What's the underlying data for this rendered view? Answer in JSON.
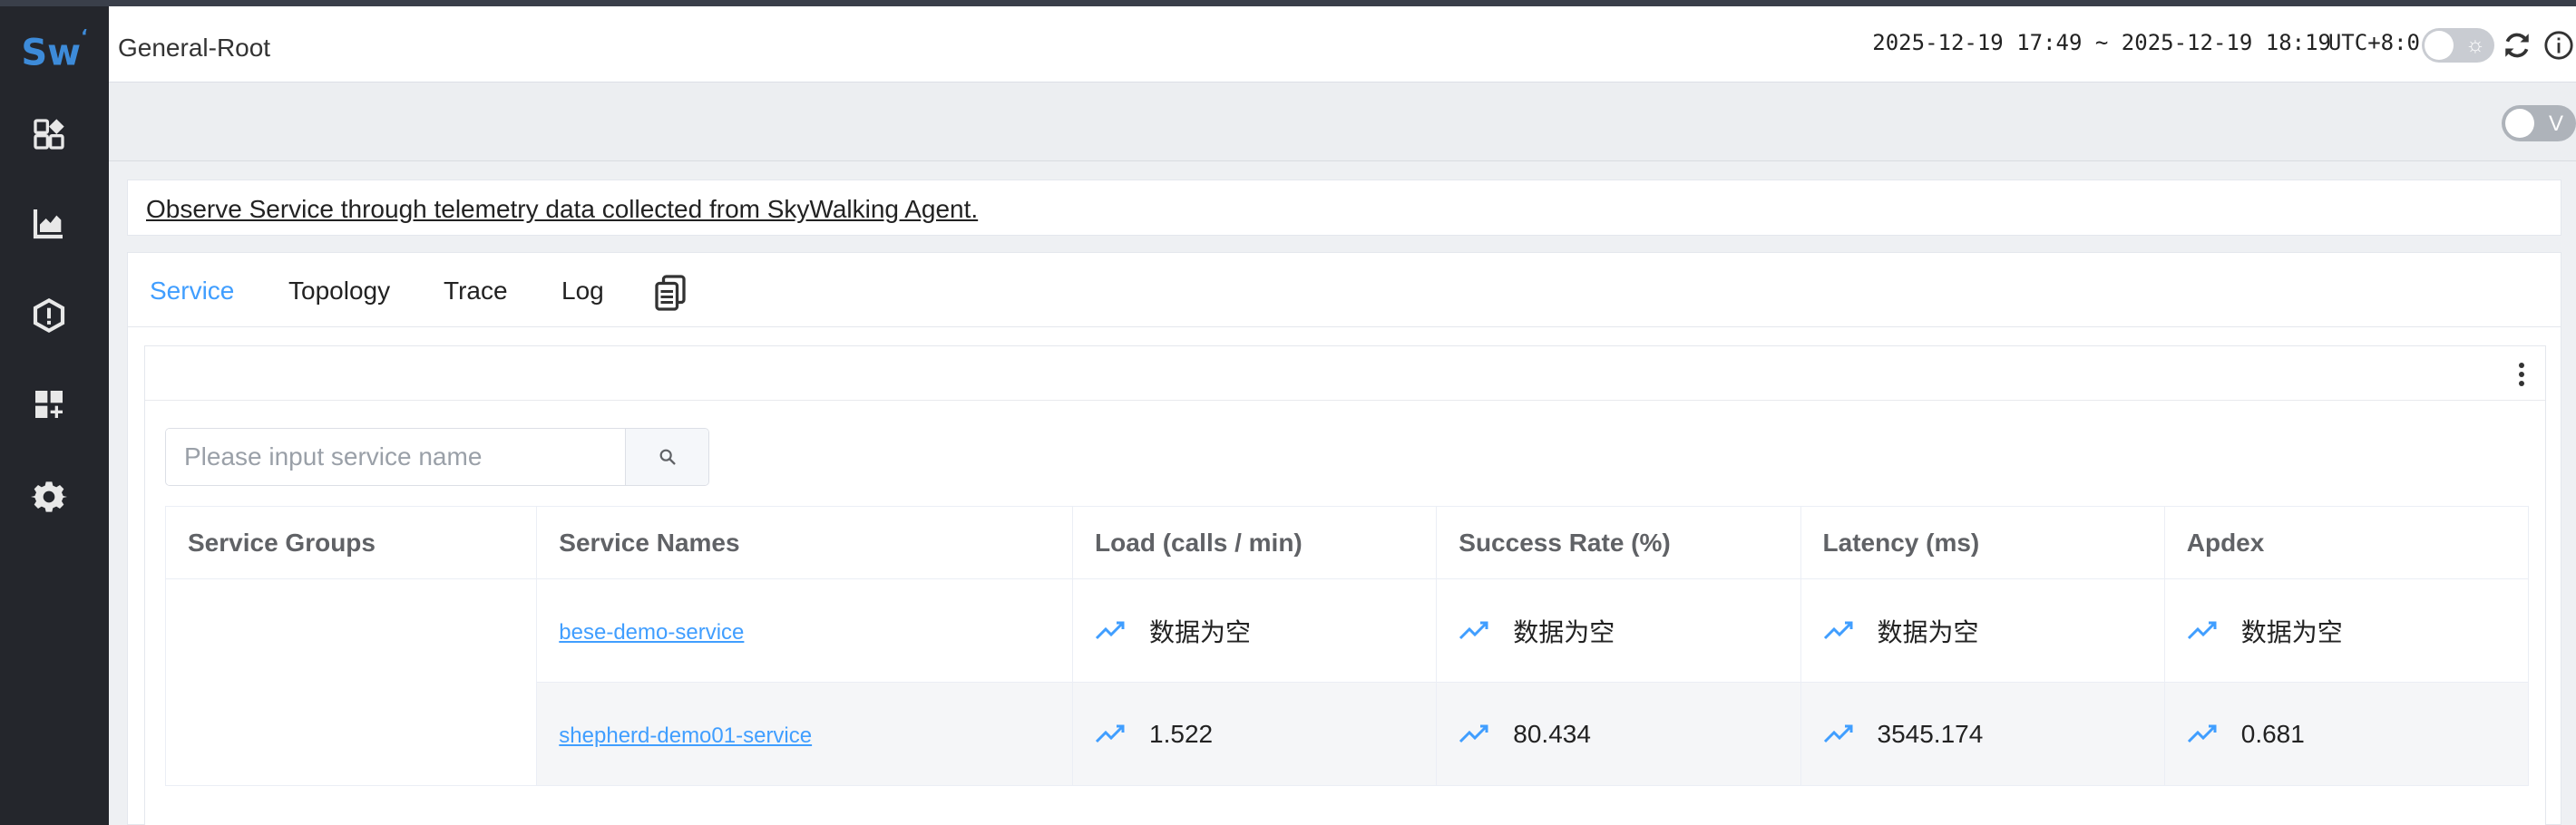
{
  "app": {
    "logo_text": "Sw",
    "accent_color": "#409eff",
    "sidebar_color": "#24262c"
  },
  "sidebar": {
    "items": [
      {
        "icon": "dashboard-icon"
      },
      {
        "icon": "chart-icon"
      },
      {
        "icon": "alert-icon"
      },
      {
        "icon": "add-widget-icon"
      },
      {
        "icon": "settings-icon"
      }
    ]
  },
  "header": {
    "title": "General-Root",
    "time_range": "2025-12-19 17:49 ~ 2025-12-19 18:19",
    "timezone": "UTC+8:0"
  },
  "toolbar": {
    "v_toggle_label": "V"
  },
  "description": "Observe Service through telemetry data collected from SkyWalking Agent.",
  "tabs": [
    {
      "label": "Service",
      "active": true
    },
    {
      "label": "Topology",
      "active": false
    },
    {
      "label": "Trace",
      "active": false
    },
    {
      "label": "Log",
      "active": false
    }
  ],
  "search": {
    "placeholder": "Please input service name"
  },
  "table": {
    "headers": [
      "Service Groups",
      "Service Names",
      "Load (calls / min)",
      "Success Rate (%)",
      "Latency (ms)",
      "Apdex"
    ],
    "rows": [
      {
        "group": "",
        "name": "bese-demo-service",
        "load": "数据为空",
        "success": "数据为空",
        "latency": "数据为空",
        "apdex": "数据为空"
      },
      {
        "group": "",
        "name": "shepherd-demo01-service",
        "load": "1.522",
        "success": "80.434",
        "latency": "3545.174",
        "apdex": "0.681"
      }
    ]
  }
}
